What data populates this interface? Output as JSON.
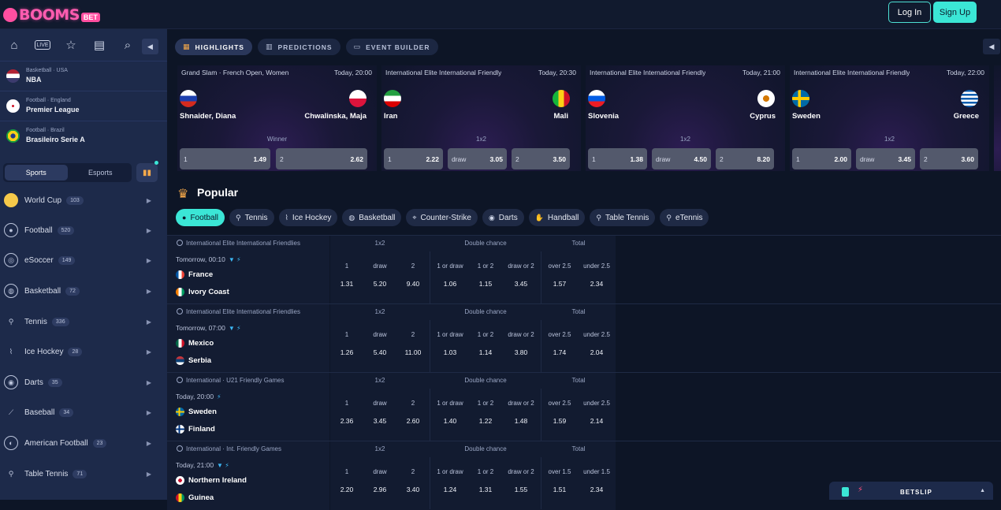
{
  "brand": {
    "logo_text": "BOOMS",
    "logo_badge": "BET"
  },
  "header": {
    "login_label": "Log In",
    "signup_label": "Sign Up"
  },
  "sidebar": {
    "live_label": "LIVE",
    "favorites": [
      {
        "category": "Basketball · USA",
        "league": "NBA"
      },
      {
        "category": "Football · England",
        "league": "Premier League"
      },
      {
        "category": "Football · Brazil",
        "league": "Brasileiro Serie A"
      }
    ],
    "segment": {
      "sports": "Sports",
      "esports": "Esports"
    },
    "sports": [
      {
        "name": "World Cup",
        "count": "103"
      },
      {
        "name": "Football",
        "count": "520"
      },
      {
        "name": "eSoccer",
        "count": "149"
      },
      {
        "name": "Basketball",
        "count": "72"
      },
      {
        "name": "Tennis",
        "count": "336"
      },
      {
        "name": "Ice Hockey",
        "count": "28"
      },
      {
        "name": "Darts",
        "count": "35"
      },
      {
        "name": "Baseball",
        "count": "34"
      },
      {
        "name": "American Football",
        "count": "23"
      },
      {
        "name": "Table Tennis",
        "count": "71"
      }
    ]
  },
  "tabs": [
    {
      "label": "HIGHLIGHTS",
      "active": true
    },
    {
      "label": "PREDICTIONS",
      "active": false
    },
    {
      "label": "EVENT BUILDER",
      "active": false
    }
  ],
  "highlights": [
    {
      "league": "Grand Slam · French Open, Women",
      "time": "Today, 20:00",
      "home": "Shnaider, Diana",
      "away": "Chwalinska, Maja",
      "market": "Winner",
      "odds": [
        {
          "k": "1",
          "v": "1.49"
        },
        {
          "k": "2",
          "v": "2.62"
        }
      ]
    },
    {
      "league": "International Elite International Friendly",
      "time": "Today, 20:30",
      "home": "Iran",
      "away": "Mali",
      "market": "1x2",
      "odds": [
        {
          "k": "1",
          "v": "2.22"
        },
        {
          "k": "draw",
          "v": "3.05"
        },
        {
          "k": "2",
          "v": "3.50"
        }
      ]
    },
    {
      "league": "International Elite International Friendly",
      "time": "Today, 21:00",
      "home": "Slovenia",
      "away": "Cyprus",
      "market": "1x2",
      "odds": [
        {
          "k": "1",
          "v": "1.38"
        },
        {
          "k": "draw",
          "v": "4.50"
        },
        {
          "k": "2",
          "v": "8.20"
        }
      ]
    },
    {
      "league": "International Elite International Friendly",
      "time": "Today, 22:00",
      "home": "Sweden",
      "away": "Greece",
      "market": "1x2",
      "odds": [
        {
          "k": "1",
          "v": "2.00"
        },
        {
          "k": "draw",
          "v": "3.45"
        },
        {
          "k": "2",
          "v": "3.60"
        }
      ]
    }
  ],
  "popular": {
    "title": "Popular",
    "chips": [
      {
        "label": "Football",
        "active": true
      },
      {
        "label": "Tennis",
        "active": false
      },
      {
        "label": "Ice Hockey",
        "active": false
      },
      {
        "label": "Basketball",
        "active": false
      },
      {
        "label": "Counter-Strike",
        "active": false
      },
      {
        "label": "Darts",
        "active": false
      },
      {
        "label": "Handball",
        "active": false
      },
      {
        "label": "Table Tennis",
        "active": false
      },
      {
        "label": "eTennis",
        "active": false
      }
    ]
  },
  "markets": {
    "m1": "1x2",
    "m2": "Double chance",
    "m3": "Total"
  },
  "events": [
    {
      "league": "International Elite International Friendlies",
      "time": "Tomorrow, 00:10",
      "home": "France",
      "away": "Ivory Coast",
      "cols": [
        "1",
        "draw",
        "2",
        "1 or draw",
        "1 or 2",
        "draw or 2",
        "over 2.5",
        "under 2.5"
      ],
      "odds": [
        "1.31",
        "5.20",
        "9.40",
        "1.06",
        "1.15",
        "3.45",
        "1.57",
        "2.34"
      ]
    },
    {
      "league": "International Elite International Friendlies",
      "time": "Tomorrow, 07:00",
      "home": "Mexico",
      "away": "Serbia",
      "cols": [
        "1",
        "draw",
        "2",
        "1 or draw",
        "1 or 2",
        "draw or 2",
        "over 2.5",
        "under 2.5"
      ],
      "odds": [
        "1.26",
        "5.40",
        "11.00",
        "1.03",
        "1.14",
        "3.80",
        "1.74",
        "2.04"
      ]
    },
    {
      "league": "International · U21 Friendly Games",
      "time": "Today, 20:00",
      "home": "Sweden",
      "away": "Finland",
      "cols": [
        "1",
        "draw",
        "2",
        "1 or draw",
        "1 or 2",
        "draw or 2",
        "over 2.5",
        "under 2.5"
      ],
      "odds": [
        "2.36",
        "3.45",
        "2.60",
        "1.40",
        "1.22",
        "1.48",
        "1.59",
        "2.14"
      ]
    },
    {
      "league": "International · Int. Friendly Games",
      "time": "Today, 21:00",
      "home": "Northern Ireland",
      "away": "Guinea",
      "cols": [
        "1",
        "draw",
        "2",
        "1 or draw",
        "1 or 2",
        "draw or 2",
        "over 1.5",
        "under 1.5"
      ],
      "odds": [
        "2.20",
        "2.96",
        "3.40",
        "1.24",
        "1.31",
        "1.55",
        "1.51",
        "2.34"
      ]
    }
  ],
  "betslip": {
    "label": "BETSLIP"
  },
  "colors": {
    "accent": "#3be6d6",
    "brand": "#ff4fa0",
    "bg": "#0d1526",
    "sidebar": "#1d2a4a"
  }
}
